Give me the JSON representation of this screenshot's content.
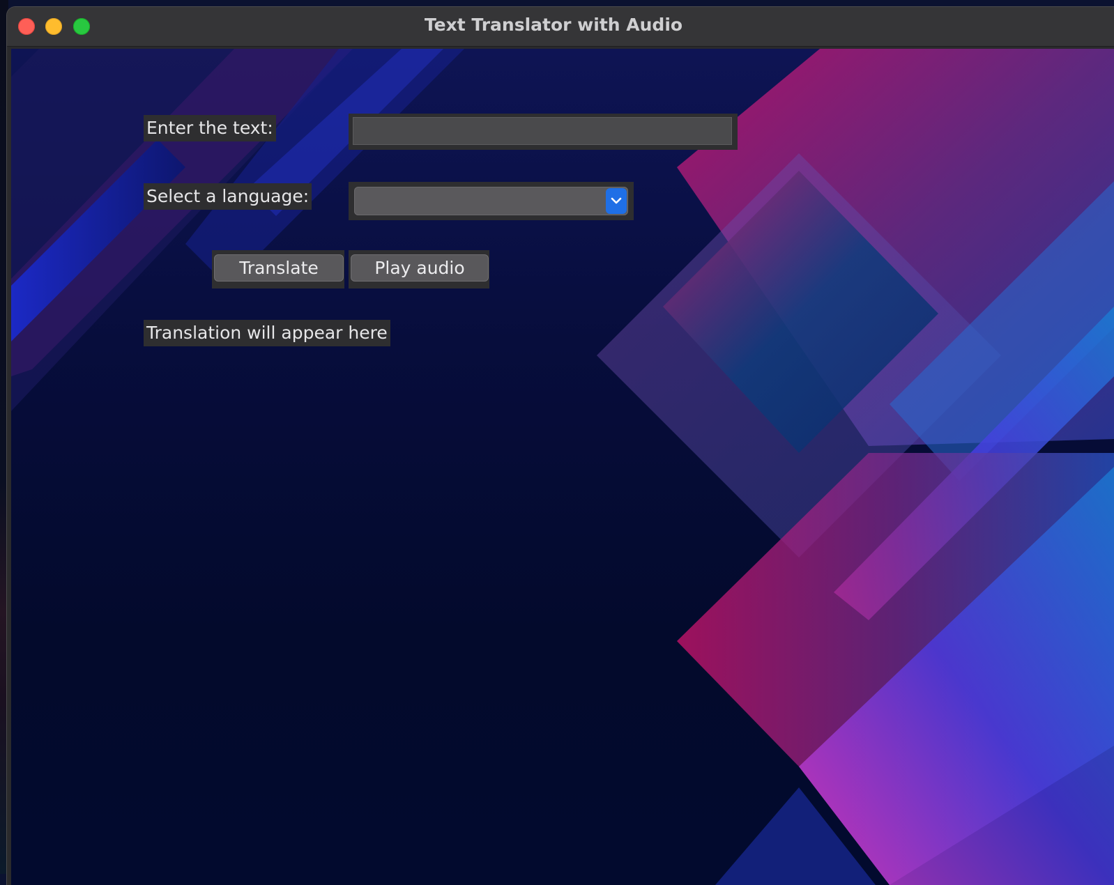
{
  "window": {
    "title": "Text Translator with Audio"
  },
  "form": {
    "text_label": "Enter the text:",
    "text_value": "",
    "language_label": "Select a language:",
    "language_value": "",
    "translate_button": "Translate",
    "play_audio_button": "Play audio",
    "result_text": "Translation will appear here"
  },
  "icons": {
    "combo_arrow": "chevron-down-icon"
  },
  "colors": {
    "close": "#fe5f57",
    "minimize": "#febc2e",
    "maximize": "#28c840",
    "accent": "#1f6fe6",
    "background": "#030a2c"
  }
}
